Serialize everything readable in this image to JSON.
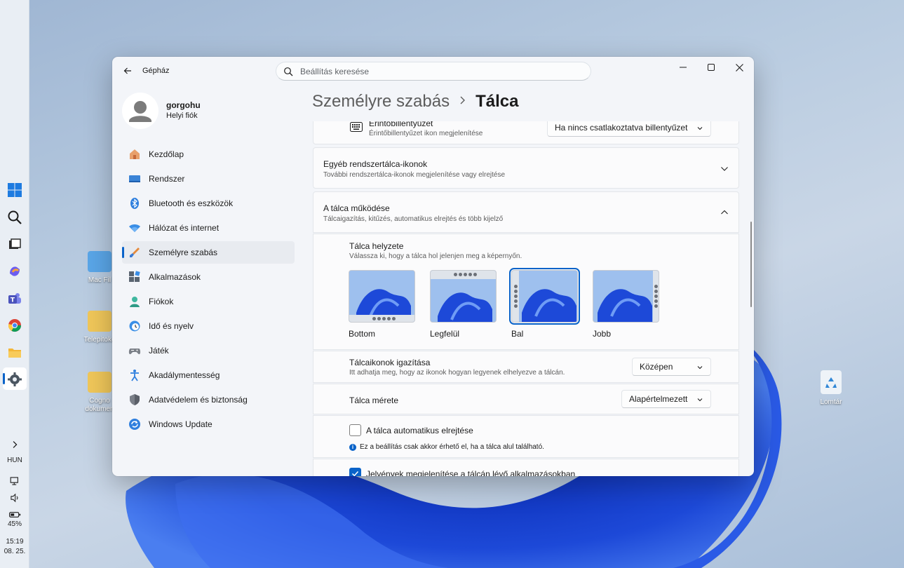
{
  "taskbar": {
    "language": "HUN",
    "battery": "45%",
    "time": "15:19",
    "date": "08. 25."
  },
  "desktop": {
    "icons": [
      {
        "label": "Mac Fil"
      },
      {
        "label": "Telepitoko"
      },
      {
        "label": "Cogno\ndokumen"
      },
      {
        "label": "Lomtár"
      }
    ]
  },
  "window": {
    "app_title": "Gépház",
    "search_placeholder": "Beállítás keresése",
    "user": {
      "name": "gorgohu",
      "account_type": "Helyi fiók"
    },
    "nav": [
      {
        "label": "Kezdőlap",
        "icon": "home-icon"
      },
      {
        "label": "Rendszer",
        "icon": "display-icon"
      },
      {
        "label": "Bluetooth és eszközök",
        "icon": "bluetooth-icon"
      },
      {
        "label": "Hálózat és internet",
        "icon": "wifi-icon"
      },
      {
        "label": "Személyre szabás",
        "icon": "brush-icon",
        "active": true
      },
      {
        "label": "Alkalmazások",
        "icon": "apps-icon"
      },
      {
        "label": "Fiókok",
        "icon": "person-icon"
      },
      {
        "label": "Idő és nyelv",
        "icon": "clock-globe-icon"
      },
      {
        "label": "Játék",
        "icon": "gamepad-icon"
      },
      {
        "label": "Akadálymentesség",
        "icon": "accessibility-icon"
      },
      {
        "label": "Adatvédelem és biztonság",
        "icon": "shield-icon"
      },
      {
        "label": "Windows Update",
        "icon": "update-icon"
      }
    ],
    "breadcrumb": {
      "parent": "Személyre szabás",
      "current": "Tálca"
    },
    "touch_keyboard": {
      "title": "Érintőbillentyűzet",
      "subtitle": "Érintőbillentyűzet ikon megjelenítése",
      "value": "Ha nincs csatlakoztatva billentyűzet"
    },
    "other_tray": {
      "title": "Egyéb rendszertálca-ikonok",
      "subtitle": "További rendszertálca-ikonok megjelenítése vagy elrejtése"
    },
    "behavior": {
      "title": "A tálca működése",
      "subtitle": "Tálcaigazítás, kitűzés, automatikus elrejtés és több kijelző",
      "position": {
        "title": "Tálca helyzete",
        "subtitle": "Válassza ki, hogy a tálca hol jelenjen meg a képernyőn.",
        "options": [
          {
            "label": "Bottom"
          },
          {
            "label": "Legfelül"
          },
          {
            "label": "Bal",
            "selected": true
          },
          {
            "label": "Jobb"
          }
        ]
      },
      "alignment": {
        "title": "Tálcaikonok igazítása",
        "subtitle": "Itt adhatja meg, hogy az ikonok hogyan legyenek elhelyezve a tálcán.",
        "value": "Középen"
      },
      "size": {
        "title": "Tálca mérete",
        "value": "Alapértelmezett"
      },
      "autohide": {
        "label": "A tálca automatikus elrejtése",
        "checked": false,
        "info": "Ez a beállítás csak akkor érhető el, ha a tálca alul található."
      },
      "badges": {
        "label": "Jelvények megjelenítése a tálcán lévő alkalmazásokban",
        "checked": true
      }
    }
  },
  "colors": {
    "accent": "#0a63c9"
  }
}
